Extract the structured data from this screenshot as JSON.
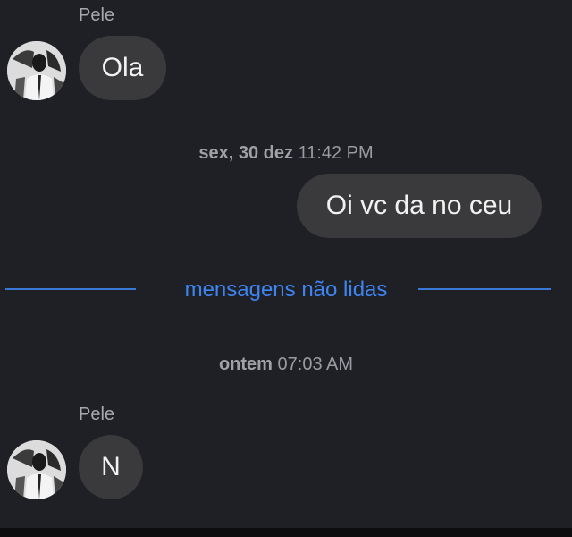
{
  "messages": [
    {
      "sender": "Pele",
      "text": "Ola"
    },
    {
      "text": "Oi vc da no ceu"
    },
    {
      "sender": "Pele",
      "text": "N"
    }
  ],
  "timestamps": [
    {
      "day": "sex, 30 dez",
      "time": "11:42 PM"
    },
    {
      "day": "ontem",
      "time": "07:03 AM"
    }
  ],
  "unread_divider": {
    "label": "mensagens não lidas",
    "color": "#3d86f2"
  },
  "colors": {
    "background": "#1f1f26",
    "bubble": "#3a3a3c",
    "accent": "#3d86f2"
  },
  "icons": {
    "avatar": "profile-photo"
  }
}
